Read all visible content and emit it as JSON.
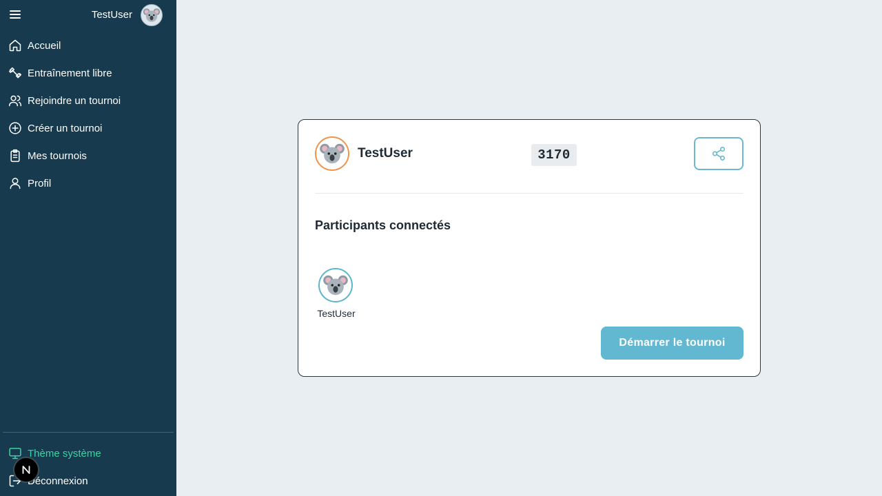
{
  "header": {
    "menu_icon": "hamburger-menu-icon",
    "username": "TestUser",
    "avatar_icon": "koala-avatar-icon"
  },
  "sidebar": {
    "items": [
      {
        "label": "Accueil",
        "icon": "home-icon"
      },
      {
        "label": "Entraînement libre",
        "icon": "dumbbell-icon"
      },
      {
        "label": "Rejoindre un tournoi",
        "icon": "users-icon"
      },
      {
        "label": "Créer un tournoi",
        "icon": "plus-circle-icon"
      },
      {
        "label": "Mes tournois",
        "icon": "clipboard-icon"
      },
      {
        "label": "Profil",
        "icon": "user-icon"
      }
    ],
    "theme": {
      "label": "Thème système",
      "icon": "monitor-icon",
      "color": "#3fd1a4"
    },
    "logout": {
      "label": "Déconnexion",
      "icon": "logout-icon"
    },
    "next_badge": "N"
  },
  "card": {
    "host": {
      "name": "TestUser",
      "avatar_icon": "koala-avatar-icon"
    },
    "tournament_code": "3170",
    "share_icon": "share-icon",
    "participants_title": "Participants connectés",
    "participants": [
      {
        "name": "TestUser",
        "avatar_icon": "koala-avatar-icon"
      }
    ],
    "start_button_label": "Démarrer le tournoi"
  },
  "colors": {
    "sidebar_bg": "#173a4f",
    "page_bg": "#e9eef2",
    "accent": "#62b8d0",
    "host_ring": "#f0934a",
    "theme_text": "#3fd1a4"
  }
}
